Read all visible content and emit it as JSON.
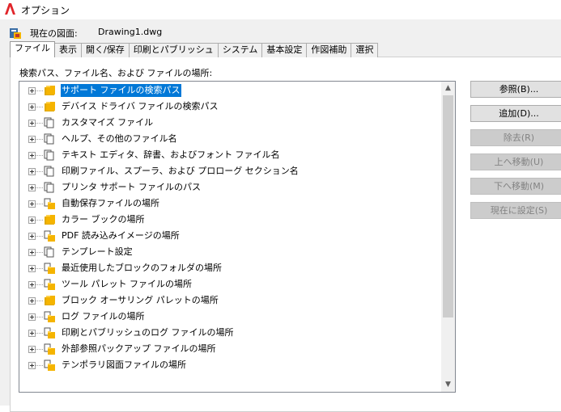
{
  "window": {
    "title": "オプション"
  },
  "header": {
    "current_drawing_label": "現在の図面:",
    "current_drawing_value": "Drawing1.dwg"
  },
  "tabs": [
    {
      "label": "ファイル",
      "active": true
    },
    {
      "label": "表示",
      "active": false
    },
    {
      "label": "開く/保存",
      "active": false
    },
    {
      "label": "印刷とパブリッシュ",
      "active": false
    },
    {
      "label": "システム",
      "active": false
    },
    {
      "label": "基本設定",
      "active": false
    },
    {
      "label": "作図補助",
      "active": false
    },
    {
      "label": "選択",
      "active": false
    }
  ],
  "tree": {
    "caption": "検索パス、ファイル名、および ファイルの場所:",
    "items": [
      {
        "label": "サポート ファイルの検索パス",
        "icon": "folder-stack-icon",
        "selected": true
      },
      {
        "label": "デバイス ドライバ ファイルの検索パス",
        "icon": "folder-stack-icon",
        "selected": false
      },
      {
        "label": "カスタマイズ ファイル",
        "icon": "file-stack-icon",
        "selected": false
      },
      {
        "label": "ヘルプ、その他のファイル名",
        "icon": "file-stack-icon",
        "selected": false
      },
      {
        "label": "テキスト エディタ、辞書、およびフォント ファイル名",
        "icon": "file-stack-icon",
        "selected": false
      },
      {
        "label": "印刷ファイル、スプーラ、および プロローグ セクション名",
        "icon": "file-stack-icon",
        "selected": false
      },
      {
        "label": "プリンタ サポート ファイルのパス",
        "icon": "file-stack-icon",
        "selected": false
      },
      {
        "label": "自動保存ファイルの場所",
        "icon": "file-folder-icon",
        "selected": false
      },
      {
        "label": "カラー ブックの場所",
        "icon": "folder-stack-icon",
        "selected": false
      },
      {
        "label": "PDF 読み込みイメージの場所",
        "icon": "file-folder-icon",
        "selected": false
      },
      {
        "label": "テンプレート設定",
        "icon": "file-stack-icon",
        "selected": false
      },
      {
        "label": "最近使用したブロックのフォルダの場所",
        "icon": "file-folder-icon",
        "selected": false
      },
      {
        "label": "ツール パレット ファイルの場所",
        "icon": "file-folder-icon",
        "selected": false
      },
      {
        "label": "ブロック オーサリング パレットの場所",
        "icon": "folder-stack-icon",
        "selected": false
      },
      {
        "label": "ログ ファイルの場所",
        "icon": "file-folder-icon",
        "selected": false
      },
      {
        "label": "印刷とパブリッシュのログ ファイルの場所",
        "icon": "file-folder-icon",
        "selected": false
      },
      {
        "label": "外部参照パックアップ ファイルの場所",
        "icon": "file-folder-icon",
        "selected": false
      },
      {
        "label": "テンポラリ図面ファイルの場所",
        "icon": "file-folder-icon",
        "selected": false
      }
    ]
  },
  "buttons": [
    {
      "label": "参照(B)...",
      "enabled": true
    },
    {
      "label": "追加(D)...",
      "enabled": true
    },
    {
      "label": "除去(R)",
      "enabled": false
    },
    {
      "label": "上へ移動(U)",
      "enabled": false
    },
    {
      "label": "下へ移動(M)",
      "enabled": false
    },
    {
      "label": "現在に設定(S)",
      "enabled": false
    }
  ],
  "colors": {
    "selection": "#0078d7",
    "folder": "#f5b400",
    "app_logo": "#e1262b"
  }
}
